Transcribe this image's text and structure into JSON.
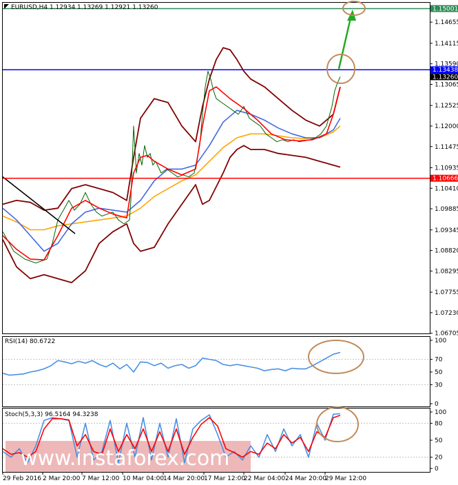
{
  "chart_data": [
    {
      "type": "line",
      "panel": "price",
      "header": "EURUSD,H4  1.12934 1.13269 1.12921 1.13260",
      "symbol": "EURUSD",
      "timeframe": "H4",
      "ohlc": {
        "open": 1.12934,
        "high": 1.13269,
        "low": 1.12921,
        "close": 1.1326
      },
      "ylim": [
        1.067,
        1.1515
      ],
      "y_ticks": [
        "1.14655",
        "1.14115",
        "1.13590",
        "1.13065",
        "1.12525",
        "1.12000",
        "1.11475",
        "1.10935",
        "1.10410",
        "1.09885",
        "1.09345",
        "1.08820",
        "1.08295",
        "1.07755",
        "1.07230",
        "1.06705"
      ],
      "x_ticks": [
        "29 Feb 2016",
        "2 Mar 20:00",
        "7 Mar 12:00",
        "10 Mar 04:00",
        "14 Mar 20:00",
        "17 Mar 12:00",
        "22 Mar 04:00",
        "24 Mar 20:00",
        "29 Mar 12:00"
      ],
      "price_tags": [
        {
          "label": "1.15001",
          "value": 1.15001,
          "line_color": "#2e8b57",
          "tag_color": "#2e8b57"
        },
        {
          "label": "1.13438",
          "value": 1.13438,
          "line_color": "#0000ff",
          "tag_color": "#0000ff"
        },
        {
          "label": "1.13260",
          "value": 1.1326,
          "line_color": "",
          "tag_color": "#000000"
        },
        {
          "label": "1.10666",
          "value": 1.10666,
          "line_color": "#ff0000",
          "tag_color": "#ff0000"
        }
      ],
      "series": [
        {
          "role": "price",
          "color": "#006400",
          "x": [
            0,
            8,
            16,
            24,
            32,
            40,
            48,
            56,
            64,
            72,
            80,
            88,
            96,
            104,
            112,
            120,
            128,
            136,
            144,
            152,
            160,
            168,
            176,
            184,
            186,
            190,
            194,
            198,
            202,
            206,
            210,
            214,
            218,
            222,
            230,
            238,
            246,
            254,
            262,
            270,
            278,
            286,
            290,
            294,
            298,
            302,
            306,
            310,
            318,
            326,
            334,
            342,
            350,
            358,
            366,
            374,
            382,
            390,
            398,
            406,
            414,
            422,
            430,
            438,
            446,
            454,
            462,
            470,
            478,
            482,
            486,
            490
          ],
          "values": [
            1.093,
            1.0905,
            1.088,
            1.087,
            1.086,
            1.0855,
            1.085,
            1.0855,
            1.086,
            1.09,
            1.096,
            1.0985,
            1.101,
            1.0985,
            1.1,
            1.103,
            1.1,
            1.098,
            1.097,
            1.0975,
            1.098,
            1.096,
            1.095,
            1.096,
            1.101,
            1.12,
            1.108,
            1.113,
            1.11,
            1.115,
            1.112,
            1.113,
            1.11,
            1.111,
            1.108,
            1.109,
            1.108,
            1.107,
            1.1075,
            1.107,
            1.108,
            1.115,
            1.123,
            1.13,
            1.134,
            1.132,
            1.129,
            1.127,
            1.126,
            1.125,
            1.124,
            1.123,
            1.125,
            1.122,
            1.121,
            1.12,
            1.118,
            1.117,
            1.116,
            1.1165,
            1.116,
            1.1165,
            1.116,
            1.1162,
            1.1165,
            1.117,
            1.118,
            1.12,
            1.125,
            1.129,
            1.131,
            1.1326
          ]
        },
        {
          "role": "ma-fast",
          "color": "#ff0000",
          "x": [
            0,
            20,
            40,
            60,
            80,
            100,
            120,
            140,
            160,
            180,
            190,
            200,
            210,
            220,
            240,
            260,
            280,
            290,
            300,
            310,
            330,
            350,
            370,
            390,
            410,
            430,
            450,
            470,
            480,
            490
          ],
          "values": [
            1.092,
            1.0885,
            1.086,
            1.0858,
            1.092,
            1.099,
            1.101,
            1.099,
            1.0975,
            1.0965,
            1.108,
            1.112,
            1.1125,
            1.111,
            1.109,
            1.1075,
            1.109,
            1.12,
            1.129,
            1.13,
            1.127,
            1.1245,
            1.1215,
            1.118,
            1.1165,
            1.1162,
            1.1165,
            1.118,
            1.123,
            1.13
          ]
        },
        {
          "role": "ma-mid",
          "color": "#4169e1",
          "x": [
            0,
            20,
            40,
            60,
            80,
            100,
            120,
            140,
            160,
            180,
            200,
            220,
            240,
            260,
            280,
            300,
            320,
            340,
            360,
            380,
            400,
            420,
            440,
            460,
            480,
            490
          ],
          "values": [
            1.099,
            1.096,
            1.092,
            1.088,
            1.09,
            1.095,
            1.098,
            1.099,
            1.0985,
            1.098,
            1.101,
            1.106,
            1.109,
            1.109,
            1.11,
            1.115,
            1.121,
            1.124,
            1.123,
            1.1215,
            1.1195,
            1.118,
            1.117,
            1.117,
            1.119,
            1.122
          ]
        },
        {
          "role": "ma-slow",
          "color": "#ffa500",
          "x": [
            0,
            20,
            40,
            60,
            80,
            100,
            120,
            140,
            160,
            180,
            200,
            220,
            240,
            260,
            280,
            300,
            320,
            340,
            360,
            380,
            400,
            420,
            440,
            460,
            480,
            490
          ],
          "values": [
            1.097,
            1.0955,
            1.0935,
            1.0935,
            1.0945,
            1.095,
            1.0955,
            1.096,
            1.0965,
            1.097,
            1.099,
            1.102,
            1.104,
            1.106,
            1.1075,
            1.111,
            1.1145,
            1.117,
            1.118,
            1.118,
            1.1175,
            1.117,
            1.1168,
            1.117,
            1.1185,
            1.12
          ]
        },
        {
          "role": "bollinger-upper",
          "color": "#800000",
          "x": [
            0,
            20,
            40,
            60,
            80,
            100,
            120,
            140,
            160,
            180,
            190,
            200,
            220,
            240,
            260,
            280,
            290,
            300,
            310,
            320,
            330,
            340,
            350,
            360,
            380,
            400,
            420,
            440,
            460,
            480,
            490
          ],
          "values": [
            1.1,
            1.101,
            1.1005,
            1.0985,
            1.099,
            1.104,
            1.105,
            1.104,
            1.103,
            1.101,
            1.112,
            1.122,
            1.127,
            1.126,
            1.12,
            1.116,
            1.125,
            1.132,
            1.137,
            1.14,
            1.1395,
            1.137,
            1.134,
            1.132,
            1.13,
            1.127,
            1.124,
            1.1215,
            1.12,
            1.123,
            1.13
          ]
        },
        {
          "role": "bollinger-lower",
          "color": "#800000",
          "x": [
            0,
            20,
            40,
            60,
            80,
            100,
            120,
            140,
            160,
            180,
            190,
            200,
            220,
            240,
            260,
            280,
            290,
            300,
            310,
            320,
            330,
            340,
            350,
            360,
            380,
            400,
            420,
            440,
            460,
            480,
            490
          ],
          "values": [
            1.091,
            1.084,
            1.081,
            1.082,
            1.081,
            1.08,
            1.083,
            1.09,
            1.093,
            1.095,
            1.09,
            1.088,
            1.089,
            1.095,
            1.1,
            1.105,
            1.1,
            1.101,
            1.1045,
            1.108,
            1.112,
            1.114,
            1.115,
            1.114,
            1.114,
            1.113,
            1.1125,
            1.112,
            1.111,
            1.11,
            1.1095
          ]
        },
        {
          "role": "trendline",
          "color": "#000000",
          "x": [
            0,
            105
          ],
          "values": [
            1.107,
            1.0925
          ]
        }
      ]
    },
    {
      "type": "line",
      "panel": "rsi",
      "header": "RSI(14) 80.6722",
      "indicator": "RSI(14)",
      "value": 80.6722,
      "ylim": [
        0,
        100
      ],
      "y_ticks": [
        "100",
        "70",
        "50",
        "30",
        "0"
      ],
      "series": [
        {
          "role": "rsi",
          "color": "#4a90e2",
          "x": [
            0,
            10,
            20,
            30,
            40,
            50,
            60,
            70,
            80,
            90,
            100,
            110,
            120,
            130,
            140,
            150,
            160,
            170,
            180,
            190,
            200,
            210,
            220,
            230,
            240,
            250,
            260,
            270,
            280,
            290,
            300,
            310,
            320,
            330,
            340,
            350,
            360,
            370,
            380,
            390,
            400,
            410,
            420,
            430,
            440,
            450,
            460,
            470,
            480,
            490
          ],
          "values": [
            48,
            45,
            46,
            47,
            50,
            52,
            55,
            60,
            68,
            66,
            63,
            67,
            64,
            68,
            62,
            58,
            64,
            55,
            62,
            50,
            66,
            65,
            60,
            64,
            56,
            60,
            62,
            56,
            60,
            72,
            70,
            68,
            62,
            60,
            62,
            60,
            58,
            56,
            52,
            54,
            55,
            52,
            56,
            55,
            55,
            60,
            66,
            72,
            78,
            81
          ]
        }
      ]
    },
    {
      "type": "line",
      "panel": "stochastic",
      "header": "Stoch(5,3,3) 96.5164 94.3238",
      "indicator": "Stoch(5,3,3)",
      "values": [
        96.5164,
        94.3238
      ],
      "ylim": [
        0,
        100
      ],
      "y_ticks": [
        "100",
        "80",
        "50",
        "20",
        "0"
      ],
      "series": [
        {
          "role": "stoch-main",
          "color": "#4a90e2",
          "x": [
            0,
            12,
            24,
            36,
            48,
            60,
            72,
            84,
            96,
            108,
            120,
            132,
            144,
            156,
            168,
            180,
            192,
            204,
            216,
            228,
            240,
            252,
            264,
            276,
            288,
            300,
            312,
            324,
            336,
            348,
            360,
            372,
            384,
            396,
            408,
            420,
            432,
            444,
            456,
            468,
            480,
            490
          ],
          "values": [
            30,
            20,
            35,
            10,
            40,
            85,
            90,
            88,
            85,
            20,
            80,
            15,
            30,
            85,
            10,
            80,
            20,
            90,
            15,
            80,
            20,
            88,
            10,
            70,
            85,
            95,
            60,
            20,
            30,
            15,
            40,
            20,
            60,
            30,
            70,
            40,
            60,
            20,
            80,
            50,
            96,
            97
          ]
        },
        {
          "role": "stoch-signal",
          "color": "#ff0000",
          "x": [
            0,
            12,
            24,
            36,
            48,
            60,
            72,
            84,
            96,
            108,
            120,
            132,
            144,
            156,
            168,
            180,
            192,
            204,
            216,
            228,
            240,
            252,
            264,
            276,
            288,
            300,
            312,
            324,
            336,
            348,
            360,
            372,
            384,
            396,
            408,
            420,
            432,
            444,
            456,
            468,
            480,
            490
          ],
          "values": [
            35,
            25,
            28,
            20,
            30,
            70,
            88,
            88,
            86,
            40,
            60,
            30,
            25,
            70,
            30,
            60,
            35,
            70,
            30,
            65,
            30,
            70,
            25,
            55,
            78,
            90,
            75,
            35,
            28,
            20,
            30,
            25,
            45,
            35,
            60,
            45,
            55,
            30,
            65,
            55,
            90,
            94
          ]
        }
      ]
    }
  ],
  "annotations": {
    "arrow_color": "#22aa22",
    "circle_color": "#c08a5a"
  },
  "watermark": "www.instaforex.com"
}
